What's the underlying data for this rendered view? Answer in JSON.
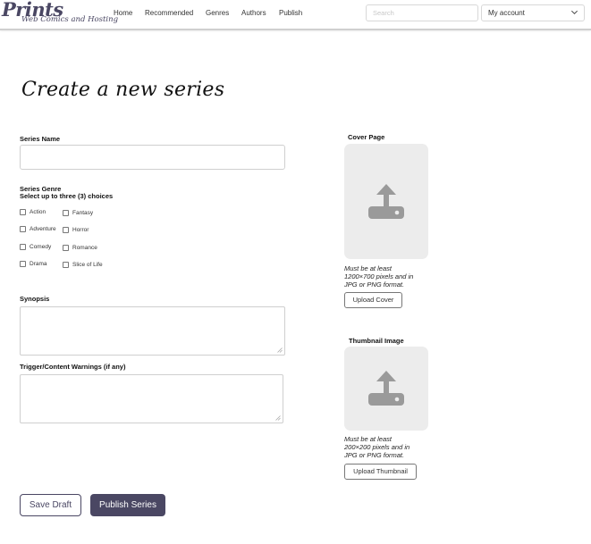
{
  "brand": {
    "name": "Prints",
    "tagline": "Web Comics and Hosting",
    "color": "#4a4763"
  },
  "nav": {
    "links": [
      "Home",
      "Recommended",
      "Genres",
      "Authors",
      "Publish"
    ]
  },
  "search": {
    "placeholder": "Search",
    "value": ""
  },
  "account": {
    "label": "My account",
    "icon": "chevron-down-icon"
  },
  "page": {
    "title": "Create a new series"
  },
  "form": {
    "series_name": {
      "label": "Series Name",
      "value": ""
    },
    "genre": {
      "label": "Series Genre",
      "sublabel": "Select up to three (3) choices",
      "options": [
        "Action",
        "Fantasy",
        "Adventure",
        "Horror",
        "Comedy",
        "Romance",
        "Drama",
        "Slice of Life"
      ],
      "checked": []
    },
    "synopsis": {
      "label": "Synopsis",
      "value": ""
    },
    "warnings": {
      "label": "Trigger/Content Warnings (if any)",
      "value": ""
    }
  },
  "cover": {
    "label": "Cover Page",
    "icon": "upload-icon",
    "note": [
      "Must be at least",
      "1200×700 pixels and in",
      "JPG or PNG format."
    ],
    "button": "Upload Cover"
  },
  "thumbnail": {
    "label": "Thumbnail Image",
    "icon": "upload-icon",
    "note": [
      "Must be at least",
      "200×200 pixels and in",
      "JPG or PNG format."
    ],
    "button": "Upload Thumbnail"
  },
  "actions": {
    "save_draft": "Save Draft",
    "publish": "Publish Series"
  },
  "colors": {
    "accent": "#4a4763",
    "upload_bg": "#ececec",
    "upload_icon": "#9a9a9a"
  }
}
